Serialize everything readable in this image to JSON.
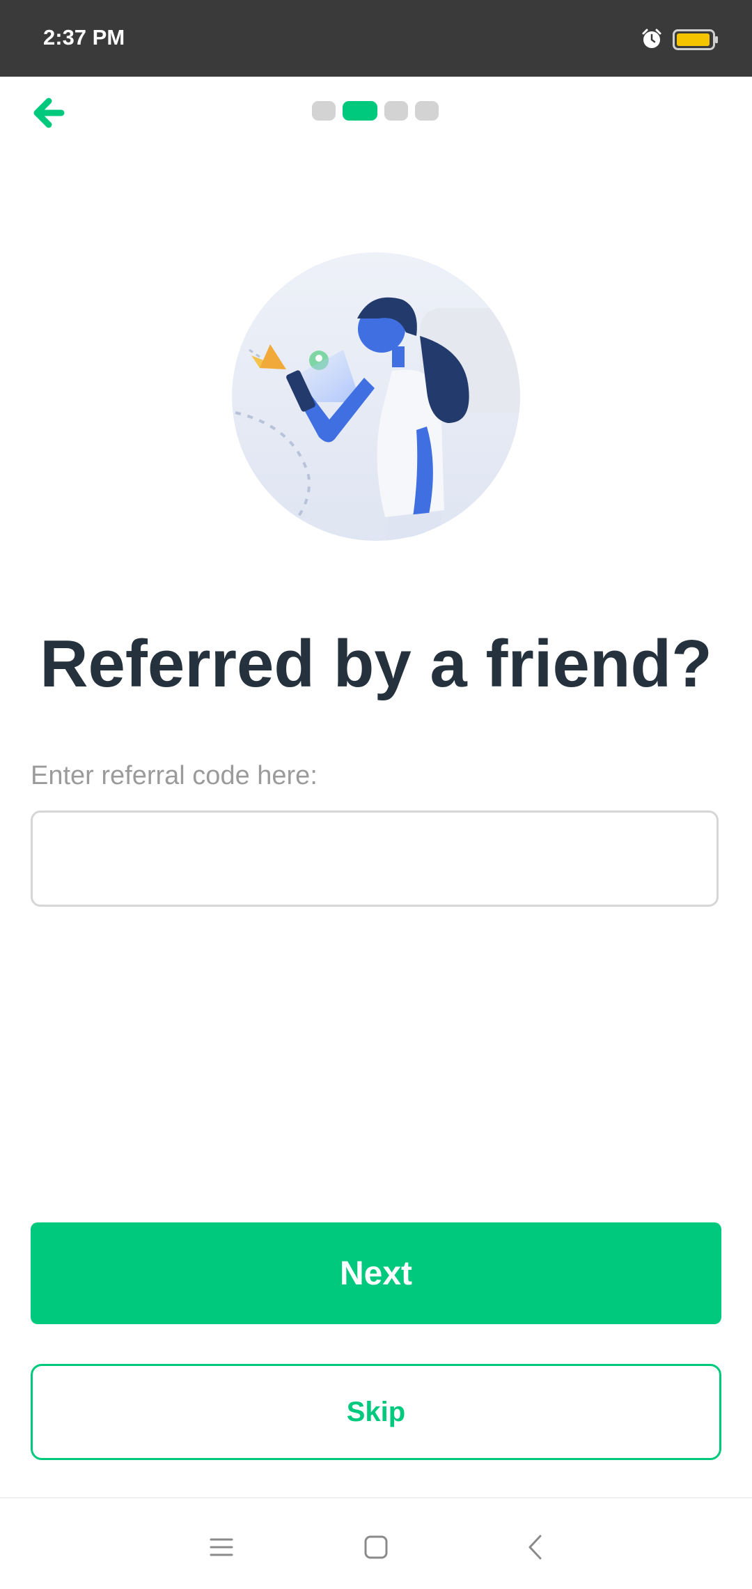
{
  "status_bar": {
    "time": "2:37 PM",
    "icons": [
      "alarm-icon",
      "battery-icon"
    ]
  },
  "header": {
    "back_icon": "arrow-left-icon",
    "steps_total": 4,
    "current_step": 2
  },
  "main": {
    "title": "Referred by a friend?",
    "referral_label": "Enter referral code here:",
    "referral_value": "",
    "referral_placeholder": ""
  },
  "actions": {
    "next_label": "Next",
    "skip_label": "Skip"
  },
  "nav_bar": {
    "icons": [
      "menu-icon",
      "home-icon",
      "back-icon"
    ]
  },
  "colors": {
    "accent": "#00c97d",
    "title": "#25313c",
    "muted": "#9b9b9b",
    "status_bar": "#3a3a3a"
  }
}
